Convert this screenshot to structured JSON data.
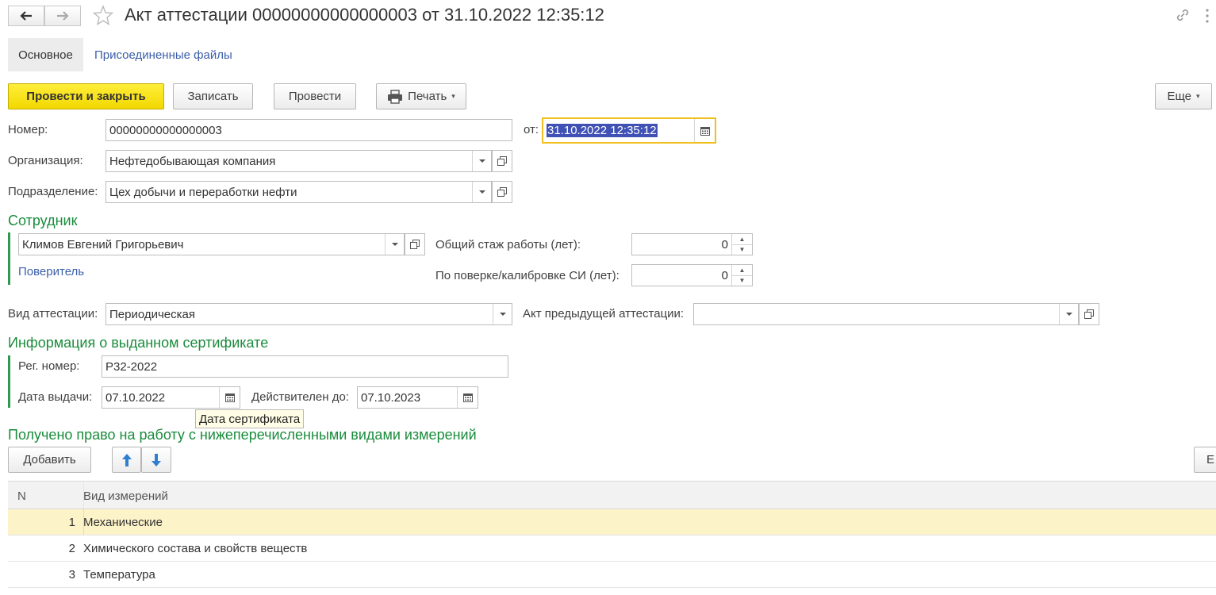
{
  "window": {
    "title": "Акт аттестации 00000000000000003 от 31.10.2022 12:35:12"
  },
  "tabs": [
    {
      "label": "Основное"
    },
    {
      "label": "Присоединенные файлы"
    }
  ],
  "toolbar": {
    "post_close_label": "Провести и закрыть",
    "save_label": "Записать",
    "post_label": "Провести",
    "print_label": "Печать",
    "more_label": "Еще"
  },
  "form": {
    "number_label": "Номер:",
    "number_value": "00000000000000003",
    "date_label": "от:",
    "date_value": "31.10.2022 12:35:12",
    "org_label": "Организация:",
    "org_value": "Нефтедобывающая компания",
    "dept_label": "Подразделение:",
    "dept_value": "Цех добычи и переработки нефти"
  },
  "employee": {
    "title": "Сотрудник",
    "name": "Климов Евгений Григорьевич",
    "role_link": "Поверитель",
    "total_exp_label": "Общий стаж работы (лет):",
    "total_exp_value": "0",
    "calib_exp_label": "По поверке/калибровке СИ (лет):",
    "calib_exp_value": "0"
  },
  "attestation": {
    "type_label": "Вид аттестации:",
    "type_value": "Периодическая",
    "prev_label": "Акт предыдущей аттестации:",
    "prev_value": ""
  },
  "certificate": {
    "title": "Информация о выданном сертификате",
    "reg_label": "Рег. номер:",
    "reg_value": "Р32-2022",
    "issue_label": "Дата выдачи:",
    "issue_value": "07.10.2022",
    "valid_label": "Действителен до:",
    "valid_value": "07.10.2023",
    "tooltip": "Дата сертификата"
  },
  "measurements": {
    "title": "Получено право на работу с нижеперечисленными видами измерений",
    "add_label": "Добавить",
    "more_label_partial": "Е",
    "columns": {
      "n": "N",
      "type": "Вид измерений"
    },
    "rows": [
      {
        "n": "1",
        "type": "Механические"
      },
      {
        "n": "2",
        "type": "Химического состава и свойств веществ"
      },
      {
        "n": "3",
        "type": "Температура"
      }
    ]
  },
  "colors": {
    "accent_green": "#1a8c3c",
    "primary_yellow": "#f5dd00",
    "selected_row": "#fdf3c8",
    "link_blue": "#3b5fa8"
  }
}
